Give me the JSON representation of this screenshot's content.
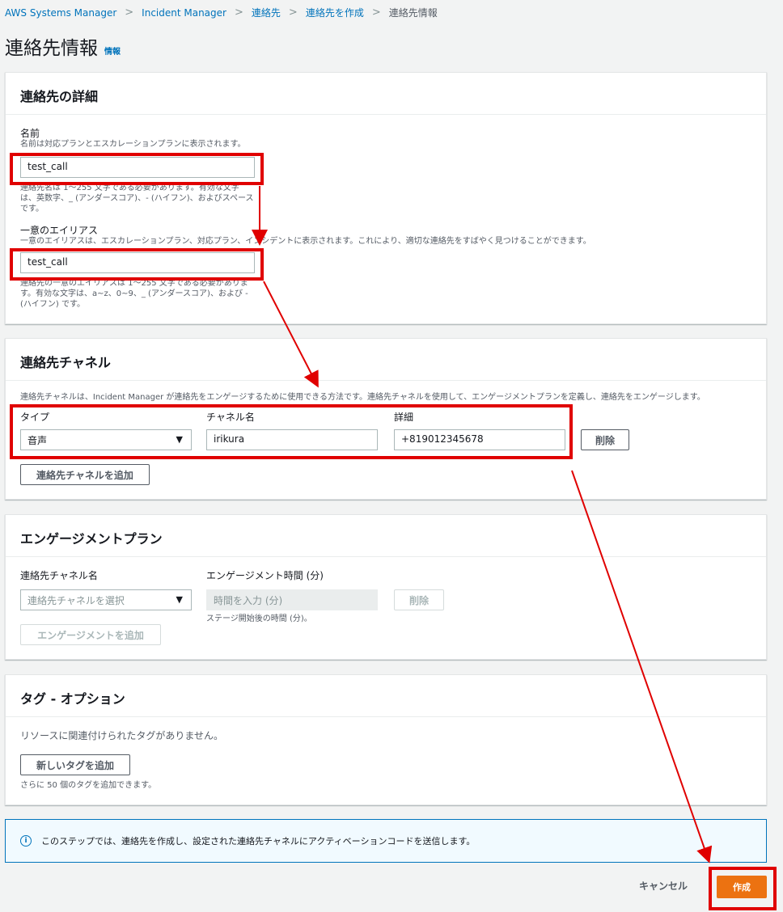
{
  "breadcrumb": {
    "items": [
      "AWS Systems Manager",
      "Incident Manager",
      "連絡先",
      "連絡先を作成"
    ],
    "current": "連絡先情報",
    "separator": ">"
  },
  "page": {
    "title": "連絡先情報",
    "info_link": "情報"
  },
  "contact_details": {
    "header": "連絡先の詳細",
    "name": {
      "label": "名前",
      "description": "名前は対応プランとエスカレーションプランに表示されます。",
      "value": "test_call",
      "constraint": "連絡先名は 1～255 文字である必要があります。有効な文字は、英数字、_ (アンダースコア)、- (ハイフン)、およびスペースです。"
    },
    "alias": {
      "label": "一意のエイリアス",
      "description": "一意のエイリアスは、エスカレーションプラン、対応プラン、インシデントに表示されます。これにより、適切な連絡先をすばやく見つけることができます。",
      "value": "test_call",
      "constraint": "連絡先の一意のエイリアスは 1～255 文字である必要があります。有効な文字は、a~z、0~9、_ (アンダースコア)、および - (ハイフン) です。"
    }
  },
  "contact_channels": {
    "header": "連絡先チャネル",
    "description": "連絡先チャネルは、Incident Manager が連絡先をエンゲージするために使用できる方法です。連絡先チャネルを使用して、エンゲージメントプランを定義し、連絡先をエンゲージします。",
    "type_label": "タイプ",
    "type_value": "音声",
    "name_label": "チャネル名",
    "name_value": "irikura",
    "detail_label": "詳細",
    "detail_value": "+819012345678",
    "remove_label": "削除",
    "add_label": "連絡先チャネルを追加"
  },
  "engagement_plan": {
    "header": "エンゲージメントプラン",
    "channel_label": "連絡先チャネル名",
    "channel_placeholder": "連絡先チャネルを選択",
    "time_label": "エンゲージメント時間 (分)",
    "time_placeholder": "時間を入力 (分)",
    "time_hint": "ステージ開始後の時間 (分)。",
    "remove_label": "削除",
    "add_label": "エンゲージメントを追加"
  },
  "tags": {
    "header": "タグ - オプション",
    "empty_text": "リソースに関連付けられたタグがありません。",
    "add_label": "新しいタグを追加",
    "hint": "さらに 50 個のタグを追加できます。"
  },
  "notice": {
    "icon": "info-icon",
    "text": "このステップでは、連絡先を作成し、設定された連絡先チャネルにアクティベーションコードを送信します。"
  },
  "footer": {
    "cancel_label": "キャンセル",
    "create_label": "作成"
  },
  "colors": {
    "accent": "#ec7211",
    "link": "#0073bb",
    "highlight": "#e00000"
  }
}
